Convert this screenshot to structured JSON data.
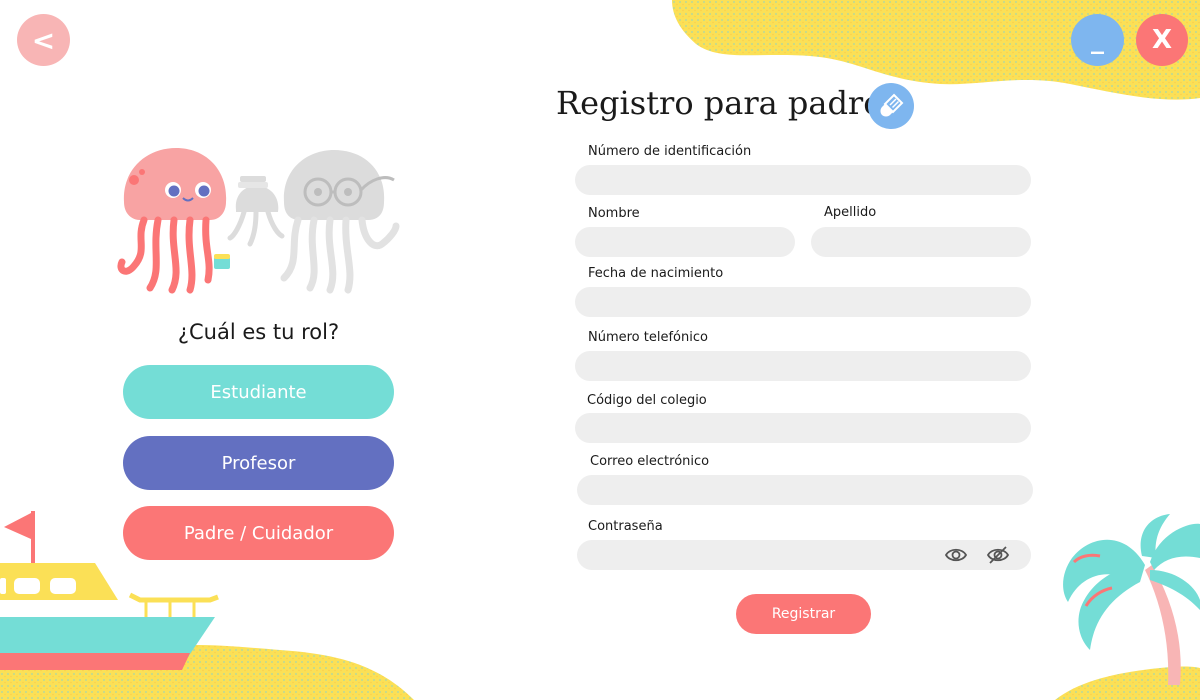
{
  "colors": {
    "coral": "#fb7676",
    "teal": "#74ddd6",
    "indigo": "#6370c1",
    "sky": "#7eb6ef",
    "pink": "#f8b5b5",
    "sand": "#fbe056",
    "field_bg": "#eeeeee"
  },
  "window": {
    "back_label": "<",
    "minimize_label": "_",
    "close_label": "X"
  },
  "roles": {
    "question": "¿Cuál es tu rol?",
    "student": "Estudiante",
    "teacher": "Profesor",
    "parent": "Padre / Cuidador"
  },
  "form": {
    "title": "Registro para padres",
    "title_icon": "paintbrush-icon",
    "labels": {
      "id_number": "Número de identificación",
      "first_name": "Nombre",
      "last_name": "Apellido",
      "birth_date": "Fecha de nacimiento",
      "phone": "Número telefónico",
      "school_code": "Código del colegio",
      "email": "Correo electrónico",
      "password": "Contraseña"
    },
    "values": {
      "id_number": "",
      "first_name": "",
      "last_name": "",
      "birth_date": "",
      "phone": "",
      "school_code": "",
      "email": "",
      "password": ""
    },
    "password_icons": [
      "eye-icon",
      "eye-slash-icon"
    ],
    "submit": "Registrar"
  },
  "decorations": [
    "jellyfish-illustration",
    "boat-illustration",
    "palm-tree-illustration",
    "sand-blob"
  ]
}
